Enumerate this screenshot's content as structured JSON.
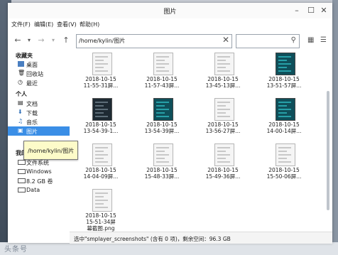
{
  "window": {
    "title": "图片"
  },
  "menu": [
    "文件(F)",
    "编辑(E)",
    "查看(V)",
    "帮助(H)"
  ],
  "path": "/home/kylin/图片",
  "sidebar": {
    "section_favorites": "收藏夹",
    "favorites": [
      "桌面",
      "回收站",
      "最近"
    ],
    "section_personal": "个人",
    "personal": [
      "文档",
      "下载",
      "音乐",
      "图片"
    ],
    "section_computer": "我的",
    "computer": [
      "文件系统",
      "Windows",
      "8.2 GB 卷",
      "Data"
    ]
  },
  "tooltip": "/home/kylin/图片",
  "files": [
    {
      "line1": "2018-10-15",
      "line2": "11-55-31屏...",
      "style": "light"
    },
    {
      "line1": "2018-10-15",
      "line2": "11-57-43屏...",
      "style": "light"
    },
    {
      "line1": "2018-10-15",
      "line2": "13-45-13屏...",
      "style": "light"
    },
    {
      "line1": "2018-10-15",
      "line2": "13-51-57屏...",
      "style": "teal"
    },
    {
      "line1": "2018-10-15",
      "line2": "13-54-39-1...",
      "style": "dark"
    },
    {
      "line1": "2018-10-15",
      "line2": "13-54-39屏...",
      "style": "teal"
    },
    {
      "line1": "2018-10-15",
      "line2": "13-56-27屏...",
      "style": "light"
    },
    {
      "line1": "2018-10-15",
      "line2": "14-00-14屏...",
      "style": "teal"
    },
    {
      "line1": "2018-10-15",
      "line2": "14-04-09屏...",
      "style": "light"
    },
    {
      "line1": "2018-10-15",
      "line2": "15-48-33屏...",
      "style": "light"
    },
    {
      "line1": "2018-10-15",
      "line2": "15-49-36屏...",
      "style": "light"
    },
    {
      "line1": "2018-10-15",
      "line2": "15-50-06屏...",
      "style": "light"
    },
    {
      "line1": "2018-10-15",
      "line2": "15-51-34屏",
      "line3": "幕截图.png",
      "style": "light"
    }
  ],
  "status": "选中\"smplayer_screenshots\" (含有 0 项)，剩余空间：96.3 GB",
  "watermark": "头条号"
}
